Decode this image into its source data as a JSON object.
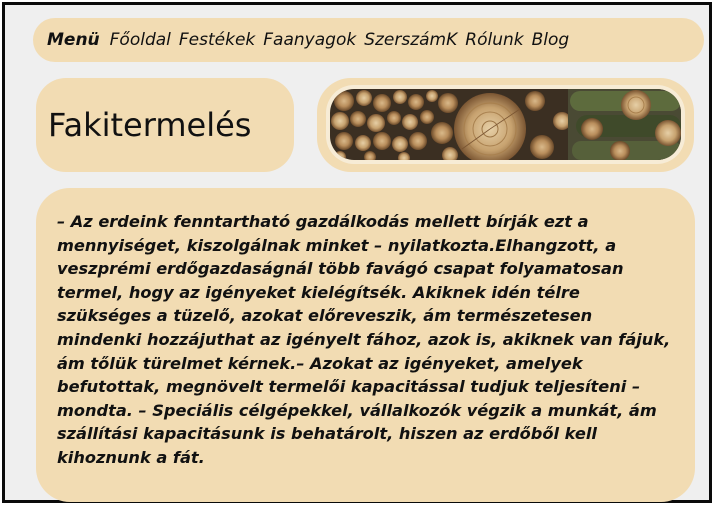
{
  "nav": {
    "menu_label": "Menü",
    "links": [
      "Főoldal",
      "Festékek",
      "Faanyagok",
      "SzerszámK",
      "Rólunk",
      "Blog"
    ]
  },
  "page_title": "Fakitermelés",
  "hero_image": {
    "icon": "stacked-firewood-logs-image"
  },
  "article": {
    "text": "– Az erdeink fenntartható gazdálkodás mellett bírják ezt a mennyiséget, kiszolgálnak minket – nyilatkozta.Elhangzott, a veszprémi erdőgazdaságnál több favágó csapat folyamatosan termel, hogy az igényeket kielégítsék. Akiknek idén télre szükséges a tüzelő, azokat előreveszik, ám természetesen mindenki hozzájuthat az igényelt fához, azok is, akiknek van fájuk, ám tőlük türelmet kérnek.– Azokat az igényeket, amelyek befutottak, megnövelt termelői kapacitással tudjuk teljesíteni – mondta. – Speciális célgépekkel, vállalkozók végzik a munkát, ám szállítási kapacitásunk is behatárolt, hiszen az erdőből kell kihoznunk a fát."
  },
  "colors": {
    "panel": "#f2dcb3",
    "background": "#efefef",
    "border": "#0a0a0a",
    "text": "#111111"
  }
}
